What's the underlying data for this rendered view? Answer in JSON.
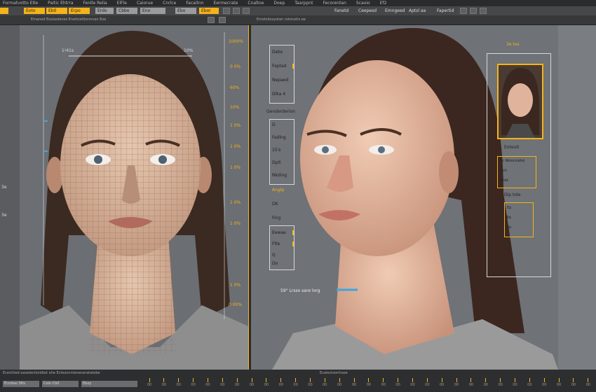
{
  "menubar": {
    "items": [
      "Formatvotto Etle",
      "Paitic Ehtrra",
      "Fenlle Relia",
      "ElFle",
      "Caiorue",
      "Cnrlce",
      "Facaitnn",
      "Eermecrate",
      "Cnaltoe",
      "Doep",
      "Taarppnt",
      "Fecorentan",
      "Scaoio",
      "Ef2"
    ]
  },
  "toolbar": {
    "buttons": [
      "Eoto",
      "Eb0",
      "Erpo",
      "Erdo",
      "Cbbo",
      "Eno",
      "Ebo",
      "Ebor"
    ],
    "right_labels": [
      "Fanetd",
      "Ceepesd",
      "Emngeed",
      "Aptsl aa",
      "Fapertid"
    ]
  },
  "left_viewport": {
    "header_text": "Emaned Eoolaolenes Eneitcelttonnnan Eoe",
    "top_left_val": "1!41s",
    "top_right_val": "10%",
    "ruler_top": "1000%",
    "ruler_ticks": [
      "0 0%",
      "60%",
      "10%",
      "1 0%",
      "1 0%",
      "1 0%",
      "1 0%",
      "1 0%",
      "1 0%",
      "0 00%"
    ],
    "left_marks": [
      "3e",
      "3e"
    ],
    "footer_text": "Ecenitted eaoelectsintbot ohe Ecteocnnteneneratatobe"
  },
  "right_viewport": {
    "header_text": "Emotsilesyoten rotonotis ee",
    "ruler_label": "3e tos",
    "panel_a": [
      "Debs",
      "Feptad",
      "Nepaed",
      "Dlka 4"
    ],
    "section_label": "Genderderion",
    "panel_b": [
      "D",
      "Fadlng",
      "15's",
      "Dplt",
      "Nkding"
    ],
    "aspect_label": "Anglp",
    "aspect_items": [
      "DK",
      "Fing"
    ],
    "panel_c": [
      "Eewae",
      "Flte",
      "Q",
      "Do"
    ],
    "thumb_label": "Eoteuit",
    "thumb_items": [
      "Ec Ablecoletal",
      "Flch",
      "Btlat"
    ],
    "morph_label": "Dip tole",
    "morph_items": [
      "Ep",
      "Ep",
      "Ep"
    ],
    "scale_text": "59° Lrsso sare lorg",
    "footer_text": "Ecalectoonhooe"
  },
  "timeline": {
    "left_items": [
      "Ecrotao Sfts",
      "Colo Cb0",
      "Eboy"
    ],
    "ticks": [
      "00",
      "00",
      "00",
      "00",
      "00",
      "00",
      "00",
      "00",
      "00",
      "00",
      "00",
      "00",
      "00",
      "00",
      "00",
      "00",
      "00",
      "00",
      "00",
      "00",
      "00",
      "00",
      "00",
      "00",
      "00",
      "00",
      "00",
      "00",
      "00",
      "00",
      "00"
    ]
  },
  "colors": {
    "accent": "#f5b31a",
    "panel": "#3a3c3f",
    "viewport": "#6f7276"
  }
}
